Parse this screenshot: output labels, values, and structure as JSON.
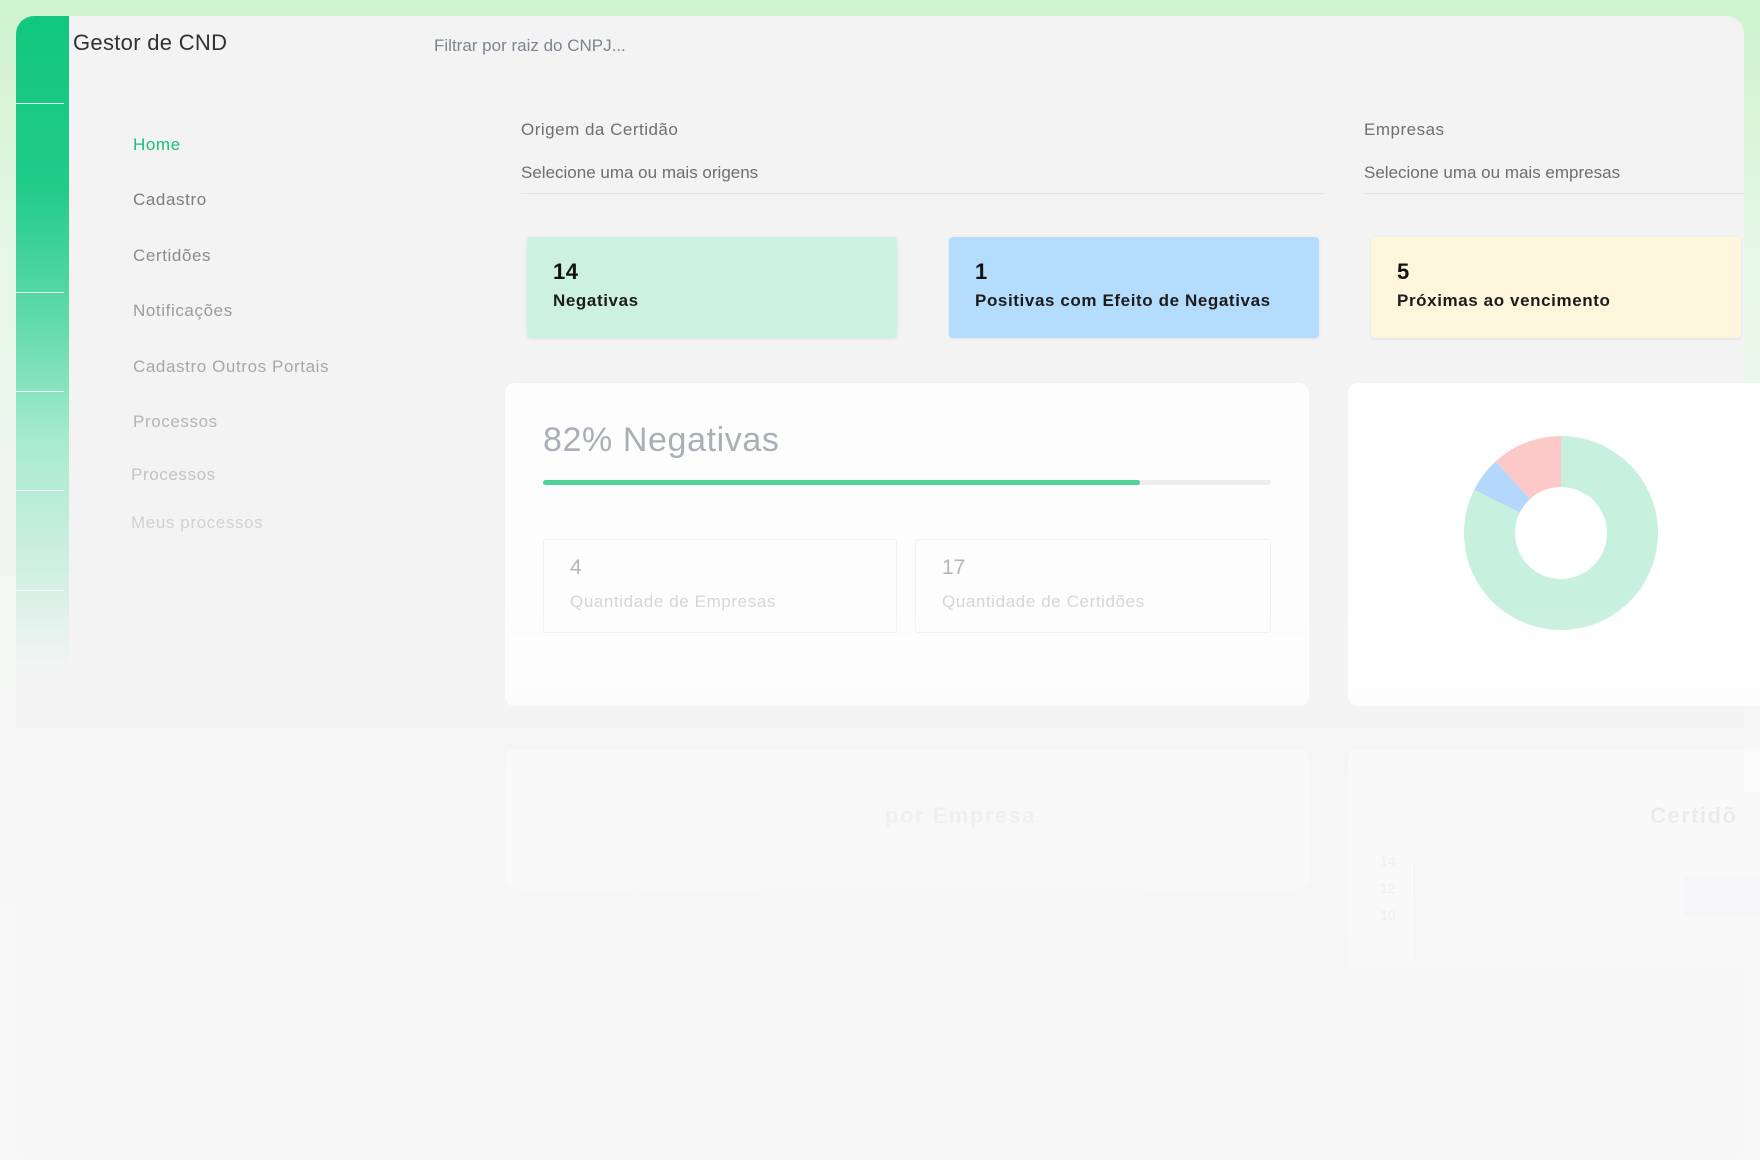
{
  "app": {
    "title": "Gestor de CND"
  },
  "search": {
    "placeholder": "Filtrar por raiz do CNPJ..."
  },
  "sidebar": {
    "items": [
      {
        "label": "Home",
        "active": true
      },
      {
        "label": "Cadastro"
      },
      {
        "label": "Certidões"
      },
      {
        "label": "Notificações"
      },
      {
        "label": "Cadastro Outros Portais"
      },
      {
        "label": "Processos"
      }
    ],
    "subitems": [
      {
        "label": "Processos"
      },
      {
        "label": "Meus processos"
      }
    ]
  },
  "filters": {
    "origin": {
      "label": "Origem da Certidão",
      "placeholder": "Selecione uma ou mais origens"
    },
    "companies": {
      "label": "Empresas",
      "placeholder": "Selecione uma ou mais empresas"
    }
  },
  "stats": [
    {
      "value": "14",
      "label": "Negativas",
      "color": "#cdf1e1"
    },
    {
      "value": "1",
      "label": "Positivas com Efeito de Negativas",
      "color": "#b4dcfd"
    },
    {
      "value": "5",
      "label": "Próximas ao vencimento",
      "color": "#fdf5dc"
    }
  ],
  "summary": {
    "title": "82% Negativas",
    "progress": 0.82,
    "companies": {
      "value": "4",
      "label": "Quantidade de Empresas"
    },
    "certificates": {
      "value": "17",
      "label": "Quantidade de Certidões"
    }
  },
  "donut": {
    "segments": [
      {
        "name": "Negativas",
        "value": 14,
        "color": "#c8f0de"
      },
      {
        "name": "Positivas com Efeito de Negativas",
        "value": 1,
        "color": "#b4d8fb"
      },
      {
        "name": "Próximas ao vencimento",
        "value": 2,
        "color": "#fdc8c8"
      }
    ]
  },
  "bottom": {
    "left_title": "por Empresa",
    "right_title": "Certidõ",
    "ticks": [
      "14",
      "12",
      "10"
    ]
  },
  "colors": {
    "accent": "#12c77f",
    "active_text": "#1dbd7c",
    "progress": "#35ca8b"
  }
}
